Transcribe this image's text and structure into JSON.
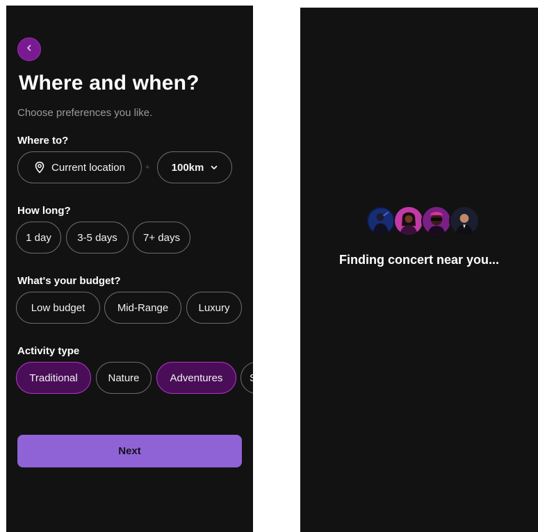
{
  "preferences_screen": {
    "back_icon": "chevron-left-icon",
    "title": "Where and when?",
    "subtitle": "Choose preferences you like.",
    "where": {
      "label": "Where to?",
      "location_chip": "Current location",
      "location_icon": "map-pin-icon",
      "separator": "+",
      "radius_chip": "100km",
      "radius_icon": "chevron-down-icon"
    },
    "how_long": {
      "label": "How long?",
      "options": [
        "1 day",
        "3-5 days",
        "7+ days"
      ]
    },
    "budget": {
      "label": "What's your budget?",
      "options": [
        "Low budget",
        "Mid-Range",
        "Luxury"
      ]
    },
    "activity": {
      "label": "Activity type",
      "options": [
        "Traditional",
        "Nature",
        "Adventures",
        "S"
      ],
      "selected": [
        "Traditional",
        "Adventures"
      ]
    },
    "next_label": "Next"
  },
  "loading_screen": {
    "message": "Finding concert near you...",
    "avatars": [
      "artist-avatar-1",
      "artist-avatar-2",
      "artist-avatar-3",
      "artist-avatar-4"
    ]
  },
  "colors": {
    "background": "#121212",
    "accent_purple": "#8f63d6",
    "selected_chip": "#4a0e58",
    "selected_border": "#b233c9",
    "back_button": "#7a1a90"
  }
}
